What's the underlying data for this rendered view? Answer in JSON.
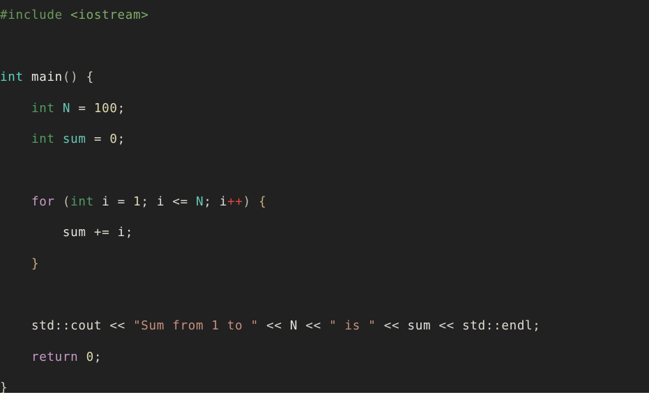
{
  "editor": {
    "background_color": "#212121",
    "page_background_color": "#ffffff",
    "language": "cpp",
    "default_text_color": "#e3e3dd",
    "font_size_px": 17.5,
    "line_height_px": 44.6,
    "indent_unit": "    "
  },
  "palette": {
    "preprocessor": "#6a9a5b",
    "include_path": "#7fae68",
    "type_keyword_signature": "#5ed4c0",
    "type_keyword": "#4f9e63",
    "identifier": "#66c9b8",
    "function_name": "#e9e9e2",
    "number_literal": "#ded9b0",
    "control_keyword": "#c79bc7",
    "operator": "#d9d9d1",
    "increment_operator": "#e0483f",
    "string_literal": "#c98f80",
    "brace_outer": "#d7d2c3",
    "brace_inner": "#c9b079",
    "plain": "#e3e3dd"
  },
  "code": {
    "full_text": "#include <iostream>\n\nint main() {\n    int N = 100;\n    int sum = 0;\n\n    for (int i = 1; i <= N; i++) {\n        sum += i;\n    }\n\n    std::cout << \"Sum from 1 to \" << N << \" is \" << sum << std::endl;\n    return 0;\n}",
    "lines": [
      {
        "indent": "",
        "text": "#include <iostream>"
      },
      {
        "indent": "",
        "text": ""
      },
      {
        "indent": "",
        "text": "int main() {"
      },
      {
        "indent": "    ",
        "text": "int N = 100;"
      },
      {
        "indent": "    ",
        "text": "int sum = 0;"
      },
      {
        "indent": "",
        "text": ""
      },
      {
        "indent": "    ",
        "text": "for (int i = 1; i <= N; i++) {"
      },
      {
        "indent": "        ",
        "text": "sum += i;"
      },
      {
        "indent": "    ",
        "text": "}"
      },
      {
        "indent": "",
        "text": ""
      },
      {
        "indent": "    ",
        "text": "std::cout << \"Sum from 1 to \" << N << \" is \" << sum << std::endl;"
      },
      {
        "indent": "    ",
        "text": "return 0;"
      },
      {
        "indent": "",
        "text": "}"
      }
    ],
    "tokens": {
      "l1_directive": "#include",
      "l1_space": " ",
      "l1_header": "<iostream>",
      "l3_indent": "",
      "l3_int": "int",
      "l3_sp1": " ",
      "l3_main": "main",
      "l3_parens": "()",
      "l3_sp2": " ",
      "l3_brace": "{",
      "l4_indent": "    ",
      "l4_int": "int",
      "l4_sp1": " ",
      "l4_name": "N",
      "l4_sp2": " ",
      "l4_eq": "=",
      "l4_sp3": " ",
      "l4_value": "100",
      "l4_semi": ";",
      "l5_indent": "    ",
      "l5_int": "int",
      "l5_sp1": " ",
      "l5_name": "sum",
      "l5_sp2": " ",
      "l5_eq": "=",
      "l5_sp3": " ",
      "l5_value": "0",
      "l5_semi": ";",
      "l7_indent": "    ",
      "l7_for": "for",
      "l7_sp1": " ",
      "l7_lparen": "(",
      "l7_int": "int",
      "l7_sp2": " ",
      "l7_i1": "i",
      "l7_sp3": " ",
      "l7_eq": "=",
      "l7_sp4": " ",
      "l7_one": "1",
      "l7_semi1": "; ",
      "l7_i2": "i",
      "l7_sp5": " ",
      "l7_le": "<=",
      "l7_sp6": " ",
      "l7_N": "N",
      "l7_semi2": "; ",
      "l7_i3": "i",
      "l7_inc": "++",
      "l7_rparen": ")",
      "l7_sp7": " ",
      "l7_brace": "{",
      "l8_indent": "        ",
      "l8_sum": "sum",
      "l8_sp1": " ",
      "l8_pluseq": "+=",
      "l8_sp2": " ",
      "l8_i": "i",
      "l8_semi": ";",
      "l9_indent": "    ",
      "l9_brace": "}",
      "l11_indent": "    ",
      "l11_std1": "std::cout",
      "l11_sp1": " ",
      "l11_shift1": "<<",
      "l11_sp2": " ",
      "l11_str1": "\"Sum from 1 to \"",
      "l11_sp3": " ",
      "l11_shift2": "<<",
      "l11_sp4": " ",
      "l11_N": "N",
      "l11_sp5": " ",
      "l11_shift3": "<<",
      "l11_sp6": " ",
      "l11_str2": "\" is \"",
      "l11_sp7": " ",
      "l11_shift4": "<<",
      "l11_sp8": " ",
      "l11_sum": "sum",
      "l11_sp9": " ",
      "l11_shift5": "<<",
      "l11_sp10": " ",
      "l11_endl": "std::endl",
      "l11_semi": ";",
      "l12_indent": "    ",
      "l12_return": "return",
      "l12_sp1": " ",
      "l12_zero": "0",
      "l12_semi": ";",
      "l13_brace": "}"
    }
  }
}
